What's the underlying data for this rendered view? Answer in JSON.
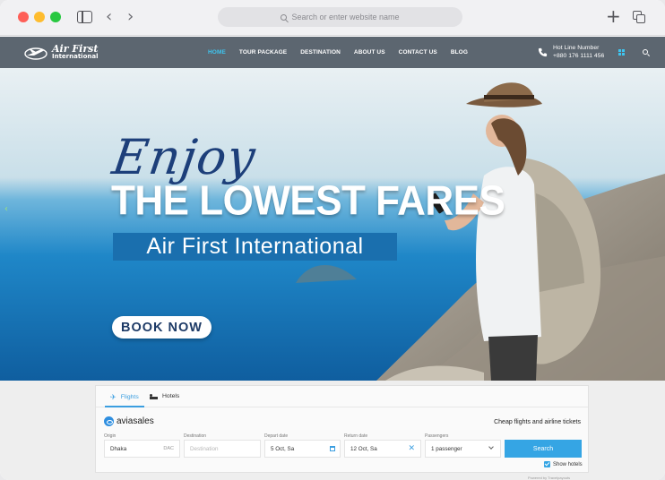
{
  "browser": {
    "address_placeholder": "Search or enter website name"
  },
  "header": {
    "logo_line1": "Air First",
    "logo_line2": "International",
    "menu": [
      {
        "label": "HOME",
        "active": true
      },
      {
        "label": "TOUR PACKAGE",
        "active": false
      },
      {
        "label": "DESTINATION",
        "active": false
      },
      {
        "label": "ABOUT US",
        "active": false
      },
      {
        "label": "CONTACT US",
        "active": false
      },
      {
        "label": "BLOG",
        "active": false
      }
    ],
    "hotline_label": "Hot Line Number",
    "hotline_number": "+880 176 1111 456",
    "accent_color": "#3ec4ef"
  },
  "hero": {
    "script_text": "Enjoy",
    "headline": "THE LOWEST FARES",
    "band_text": "Air First International",
    "cta_label": "BOOK NOW",
    "prev_arrow": "‹"
  },
  "search_widget": {
    "tabs": [
      {
        "label": "Flights",
        "icon": "plane-icon",
        "active": true
      },
      {
        "label": "Hotels",
        "icon": "bed-icon",
        "active": false
      }
    ],
    "brand": "aviasales",
    "tagline": "Cheap flights and airline tickets",
    "fields": {
      "origin": {
        "label": "Origin",
        "value": "Dhaka",
        "code": "DAC"
      },
      "destination": {
        "label": "Destination",
        "placeholder": "Destination"
      },
      "depart": {
        "label": "Depart date",
        "value": "5 Oct, Sa"
      },
      "return": {
        "label": "Return date",
        "value": "12 Oct, Sa"
      },
      "passengers": {
        "label": "Passengers",
        "value": "1 passenger"
      }
    },
    "search_label": "Search",
    "show_hotels_label": "Show hotels",
    "show_hotels_checked": true,
    "powered_by": "Powered by Travelpayouts",
    "button_color": "#35a5e4"
  }
}
